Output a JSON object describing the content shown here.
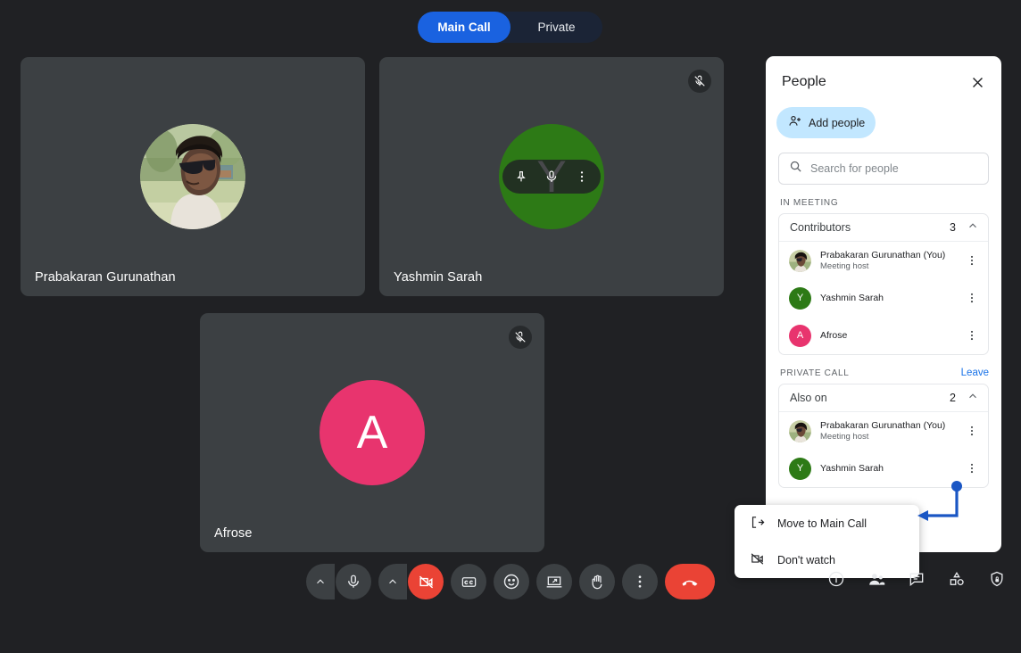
{
  "call_toggle": {
    "main_label": "Main Call",
    "private_label": "Private",
    "active": "Main Call",
    "active_color": "#1a62e0"
  },
  "tiles": [
    {
      "name": "Prabakaran Gurunathan",
      "avatar_type": "photo",
      "muted": false
    },
    {
      "name": "Yashmin Sarah",
      "avatar_type": "letter",
      "initial": "Y",
      "avatar_color": "#2d7a16",
      "muted": true
    },
    {
      "name": "Afrose",
      "avatar_type": "letter",
      "initial": "A",
      "avatar_color": "#e8346e",
      "muted": true
    }
  ],
  "tile_hover_actions": [
    "pin-icon",
    "microphone-icon",
    "more-vert-icon"
  ],
  "panel": {
    "title": "People",
    "close_icon": "close-icon",
    "add_people_label": "Add people",
    "add_people_icon": "person-add-icon",
    "add_people_color": "#c2e7ff",
    "search": {
      "placeholder": "Search for people",
      "value": "",
      "icon": "search-icon"
    },
    "in_meeting_label": "IN MEETING",
    "contributors": {
      "group_label": "Contributors",
      "count": "3",
      "chevron": "chevron-up-icon",
      "members": [
        {
          "name": "Prabakaran Gurunathan (You)",
          "subtitle": "Meeting host",
          "avatar_type": "photo"
        },
        {
          "name": "Yashmin Sarah",
          "subtitle": "",
          "avatar_type": "letter",
          "initial": "Y",
          "avatar_color": "#2d7a16"
        },
        {
          "name": "Afrose",
          "subtitle": "",
          "avatar_type": "letter",
          "initial": "A",
          "avatar_color": "#e8346e"
        }
      ]
    },
    "private_call_label": "PRIVATE CALL",
    "leave_label": "Leave",
    "leave_color": "#1a73e8",
    "also_on": {
      "group_label": "Also on",
      "count": "2",
      "chevron": "chevron-up-icon",
      "members": [
        {
          "name": "Prabakaran Gurunathan (You)",
          "subtitle": "Meeting host",
          "avatar_type": "photo"
        },
        {
          "name": "Yashmin Sarah",
          "subtitle": "",
          "avatar_type": "letter",
          "initial": "Y",
          "avatar_color": "#2d7a16"
        }
      ]
    }
  },
  "context_menu": {
    "items": [
      {
        "label": "Move to Main Call",
        "icon": "move-out-icon"
      },
      {
        "label": "Don't watch",
        "icon": "video-off-icon"
      }
    ]
  },
  "annotation": {
    "color": "#1a56c4",
    "shape": "elbow-arrow-left"
  },
  "controls": [
    {
      "name": "microphone-options",
      "icon": "chevron-up-icon"
    },
    {
      "name": "microphone-toggle",
      "icon": "microphone-icon",
      "state": "on"
    },
    {
      "name": "camera-options",
      "icon": "chevron-up-icon"
    },
    {
      "name": "camera-toggle",
      "icon": "video-off-icon",
      "state": "off",
      "color": "#ea4335"
    },
    {
      "name": "captions-toggle",
      "icon": "closed-caption-icon"
    },
    {
      "name": "reactions",
      "icon": "emoji-smile-icon"
    },
    {
      "name": "present-screen",
      "icon": "present-screen-icon"
    },
    {
      "name": "raise-hand",
      "icon": "raise-hand-icon"
    },
    {
      "name": "more-options",
      "icon": "more-vert-icon"
    },
    {
      "name": "end-call",
      "icon": "end-call-icon",
      "color": "#ea4335"
    }
  ],
  "right_icons": [
    {
      "name": "meeting-info",
      "icon": "info-icon"
    },
    {
      "name": "people-panel",
      "icon": "people-icon"
    },
    {
      "name": "chat-panel",
      "icon": "chat-icon"
    },
    {
      "name": "activities-panel",
      "icon": "shapes-icon"
    },
    {
      "name": "host-controls",
      "icon": "shield-lock-icon"
    }
  ]
}
